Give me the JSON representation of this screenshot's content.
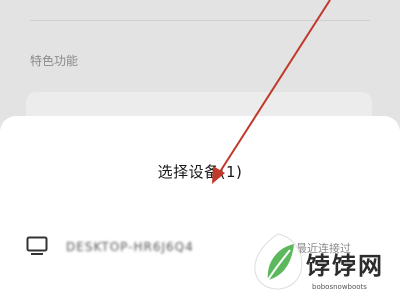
{
  "background": {
    "section_title": "特色功能"
  },
  "sheet": {
    "title": "选择设备(1)",
    "devices": [
      {
        "icon": "monitor-icon",
        "name": "DESKTOP-HR6J6Q4",
        "status": "最近连接过"
      }
    ]
  },
  "watermark": {
    "brand": "饽饽网",
    "url": "bobosnowboots"
  },
  "colors": {
    "arrow": "#c0392b",
    "sheet_bg": "#ffffff",
    "page_bg": "#e3e3e3",
    "logo_green": "#5cb85c"
  }
}
